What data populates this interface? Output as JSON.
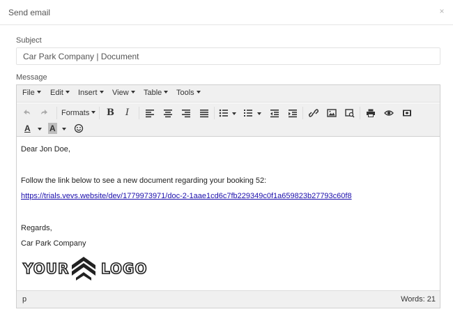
{
  "dialog": {
    "title": "Send email",
    "close_label": "×"
  },
  "subject": {
    "label": "Subject",
    "value": "Car Park Company | Document"
  },
  "message": {
    "label": "Message"
  },
  "menubar": {
    "items": [
      "File",
      "Edit",
      "Insert",
      "View",
      "Table",
      "Tools"
    ]
  },
  "toolbar": {
    "formats_label": "Formats",
    "bold_label": "B",
    "italic_label": "I",
    "text_color_label": "A",
    "bg_color_label": "A",
    "icons": [
      "undo-icon",
      "redo-icon",
      "align-left-icon",
      "align-center-icon",
      "align-right-icon",
      "align-justify-icon",
      "bullet-list-icon",
      "numbered-list-icon",
      "outdent-icon",
      "indent-icon",
      "link-icon",
      "image-icon",
      "media-icon",
      "print-icon",
      "preview-icon",
      "code-icon",
      "emoji-icon"
    ]
  },
  "body": {
    "greeting": "Dear Jon Doe,",
    "intro": "Follow the link below to see a new document regarding your booking 52:",
    "link": "https://trials.vevs.website/dev/1779973971/doc-2-1aae1cd6c7fb229349c0f1a659823b27793c60f8",
    "closing": "Regards,",
    "signature": "Car Park Company",
    "logo_left": "YOUR",
    "logo_right": "LOGO"
  },
  "statusbar": {
    "path": "p",
    "words": "Words: 21"
  },
  "colors": {
    "link": "#1a0dab",
    "toolbar_bg": "#f0f0f0",
    "border": "#cfcfcf"
  }
}
